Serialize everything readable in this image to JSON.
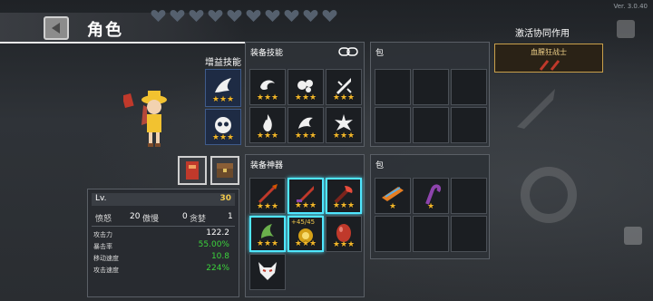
{
  "header": {
    "title": "角色",
    "version": "Ver. 3.0.40"
  },
  "hearts": {
    "count": 10,
    "color": "#55606e"
  },
  "character": {
    "skill_label": "增益技能",
    "skill_slots": [
      {
        "stars": 3
      },
      {
        "stars": 3
      }
    ]
  },
  "stats": {
    "level_label": "Lv.",
    "level_value": "30",
    "attributes": [
      {
        "name": "愤怒",
        "value": "20"
      },
      {
        "name": "傲慢",
        "value": "0"
      },
      {
        "name": "贪婪",
        "value": "1"
      }
    ],
    "rows": [
      {
        "name": "攻击力",
        "value": "122.2",
        "color": "#ffffff"
      },
      {
        "name": "暴击率",
        "value": "55.00%",
        "color": "#3cd33c"
      },
      {
        "name": "移动速度",
        "value": "10.8",
        "color": "#3cd33c"
      },
      {
        "name": "攻击速度",
        "value": "224%",
        "color": "#3cd33c"
      }
    ]
  },
  "equipped_skills": {
    "title": "装备技能",
    "slots": [
      {
        "stars": 3
      },
      {
        "stars": 3
      },
      {
        "stars": 3
      },
      {
        "stars": 3
      },
      {
        "stars": 3
      },
      {
        "stars": 3
      }
    ]
  },
  "skill_bag": {
    "title": "包",
    "slot_count": 6
  },
  "equipped_artifacts": {
    "title": "装备神器",
    "slots": [
      {
        "stars": 3,
        "icon": "spear-icon",
        "glow": false
      },
      {
        "stars": 3,
        "icon": "red-blade-icon",
        "glow": true
      },
      {
        "stars": 3,
        "icon": "crimson-axe-icon",
        "glow": true
      },
      {
        "stars": 3,
        "icon": "green-claw-icon",
        "glow": true
      },
      {
        "stars": 3,
        "icon": "gold-coin-icon",
        "glow": false,
        "counter": "+45/45"
      },
      {
        "stars": 3,
        "icon": "red-egg-icon",
        "glow": false
      },
      {
        "stars": 0,
        "icon": "fox-mask-icon",
        "glow": false
      }
    ]
  },
  "artifact_bag": {
    "title": "包",
    "items": [
      {
        "stars": 1,
        "icon": "orange-scroll-icon"
      },
      {
        "stars": 1,
        "icon": "purple-crook-icon"
      }
    ],
    "slot_count": 6
  },
  "synergy": {
    "title": "激活协同作用",
    "badge": "血腥狂战士"
  },
  "colors": {
    "star": "#f2b72a",
    "glow": "#4fe6ff",
    "level": "#f2c94c",
    "positive": "#3cd33c"
  }
}
